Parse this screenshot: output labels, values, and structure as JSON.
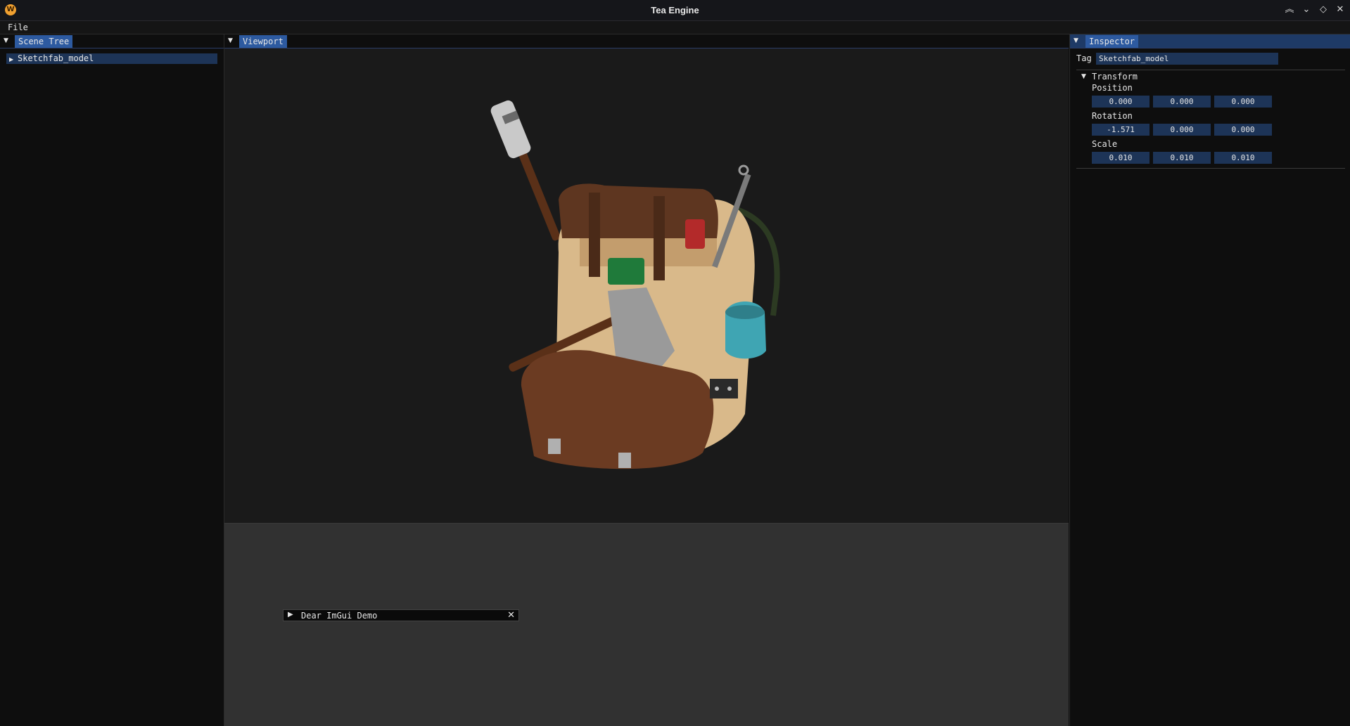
{
  "app": {
    "title": "Tea Engine",
    "logo_glyph": "W"
  },
  "window_controls": [
    "︽",
    "⌄",
    "◇",
    "✕"
  ],
  "menubar": {
    "items": [
      "File"
    ]
  },
  "scene_tree": {
    "tab_label": "Scene Tree",
    "nodes": [
      {
        "label": "Sketchfab_model",
        "expanded": false,
        "selected": true
      }
    ]
  },
  "viewport": {
    "tab_label": "Viewport",
    "scene_description_icon": "backpack-model",
    "demo_window": {
      "title": "Dear ImGui Demo",
      "collapsed": true
    }
  },
  "inspector": {
    "tab_label": "Inspector",
    "tag_label": "Tag",
    "tag_value": "Sketchfab_model",
    "transform": {
      "header": "Transform",
      "position_label": "Position",
      "position": [
        "0.000",
        "0.000",
        "0.000"
      ],
      "rotation_label": "Rotation",
      "rotation": [
        "-1.571",
        "0.000",
        "0.000"
      ],
      "scale_label": "Scale",
      "scale": [
        "0.010",
        "0.010",
        "0.010"
      ]
    }
  },
  "colors": {
    "accent": "#2d5aa0",
    "field_bg": "#1d3457",
    "viewport_bg": "#1a1a1a",
    "dock_bg": "#313131"
  }
}
